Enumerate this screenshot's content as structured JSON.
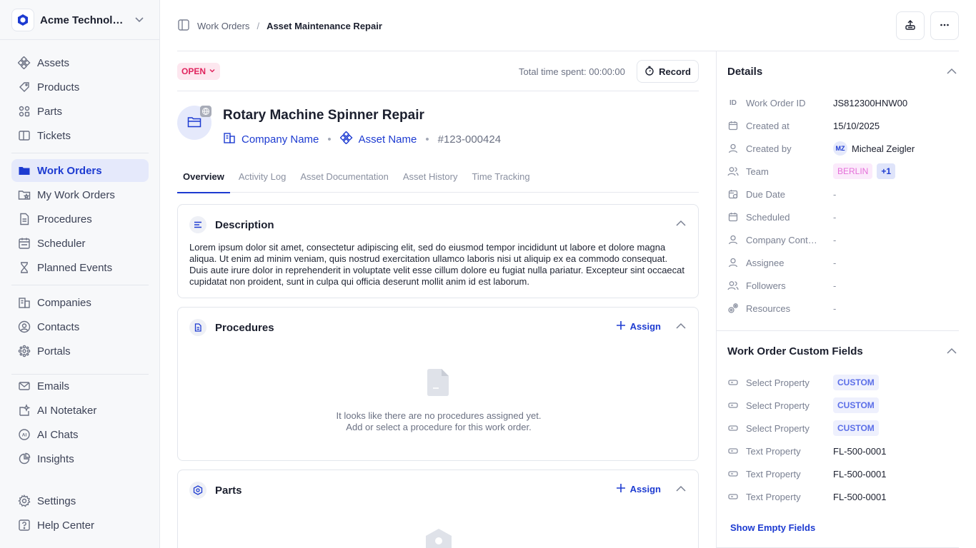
{
  "org": {
    "name": "Acme Technologies"
  },
  "nav": {
    "group1": [
      {
        "label": "Assets",
        "icon": "assets-icon"
      },
      {
        "label": "Products",
        "icon": "products-icon"
      },
      {
        "label": "Parts",
        "icon": "parts-icon"
      },
      {
        "label": "Tickets",
        "icon": "tickets-icon"
      }
    ],
    "group2": [
      {
        "label": "Work Orders",
        "icon": "work-orders-icon",
        "active": true
      },
      {
        "label": "My Work Orders",
        "icon": "my-work-orders-icon"
      },
      {
        "label": "Procedures",
        "icon": "procedures-icon"
      },
      {
        "label": "Scheduler",
        "icon": "scheduler-icon"
      },
      {
        "label": "Planned Events",
        "icon": "hourglass-icon"
      }
    ],
    "group3": [
      {
        "label": "Companies",
        "icon": "companies-icon"
      },
      {
        "label": "Contacts",
        "icon": "contacts-icon"
      },
      {
        "label": "Portals",
        "icon": "portals-icon"
      }
    ],
    "group4": [
      {
        "label": "Emails",
        "icon": "emails-icon"
      },
      {
        "label": "AI Notetaker",
        "icon": "ai-notetaker-icon"
      },
      {
        "label": "AI Chats",
        "icon": "ai-chats-icon"
      },
      {
        "label": "Insights",
        "icon": "insights-icon"
      }
    ],
    "group5": [
      {
        "label": "Settings",
        "icon": "settings-icon"
      },
      {
        "label": "Help Center",
        "icon": "help-center-icon"
      }
    ]
  },
  "breadcrumb": {
    "parent": "Work Orders",
    "separator": "/",
    "current": "Asset Maintenance Repair"
  },
  "status": {
    "label": "OPEN"
  },
  "time": {
    "label": "Total time spent: 00:00:00",
    "record_label": "Record"
  },
  "work_order": {
    "title": "Rotary Machine Spinner Repair",
    "company": "Company Name",
    "asset": "Asset Name",
    "number": "#123-000424"
  },
  "tabs": [
    "Overview",
    "Activity Log",
    "Asset Documentation",
    "Asset History",
    "Time Tracking"
  ],
  "description": {
    "title": "Description",
    "text": "Lorem ipsum dolor sit amet, consectetur adipiscing elit, sed do eiusmod tempor incididunt ut labore et dolore magna aliqua. Ut enim ad minim veniam, quis nostrud exercitation ullamco laboris nisi ut aliquip ex ea commodo consequat. Duis aute irure dolor in reprehenderit in voluptate velit esse cillum dolore eu fugiat nulla pariatur. Excepteur sint occaecat cupidatat non proident, sunt in culpa qui officia deserunt mollit anim id est laborum."
  },
  "procedures": {
    "title": "Procedures",
    "assign_label": "Assign",
    "empty_line1": "It looks like there are no procedures assigned yet.",
    "empty_line2": "Add or select a procedure for this work order."
  },
  "parts": {
    "title": "Parts",
    "assign_label": "Assign"
  },
  "details": {
    "title": "Details",
    "rows": [
      {
        "label": "Work Order ID",
        "value": "JS812300HNW00"
      },
      {
        "label": "Created at",
        "value": "15/10/2025"
      },
      {
        "label": "Created by",
        "value": "Micheal Zeigler",
        "initials": "MZ"
      },
      {
        "label": "Team",
        "value": "BERLIN",
        "extra": "+1"
      },
      {
        "label": "Due Date",
        "value": "-"
      },
      {
        "label": "Scheduled",
        "value": "-"
      },
      {
        "label": "Company Contact",
        "value": "-"
      },
      {
        "label": "Assignee",
        "value": "-"
      },
      {
        "label": "Followers",
        "value": "-"
      },
      {
        "label": "Resources",
        "value": "-"
      }
    ],
    "id_prefix": "ID"
  },
  "custom_fields": {
    "title": "Work Order Custom Fields",
    "rows": [
      {
        "label": "Select Property",
        "value": "CUSTOM"
      },
      {
        "label": "Select Property",
        "value": "CUSTOM"
      },
      {
        "label": "Select Property",
        "value": "CUSTOM"
      },
      {
        "label": "Text Property",
        "value": "FL-500-0001"
      },
      {
        "label": "Text Property",
        "value": "FL-500-0001"
      },
      {
        "label": "Text Property",
        "value": "FL-500-0001"
      }
    ],
    "show_empty_label": "Show Empty Fields"
  },
  "colors": {
    "accent": "#1d3bd1",
    "status_open": "#e0245e",
    "team_chip": "#e56fd9"
  }
}
